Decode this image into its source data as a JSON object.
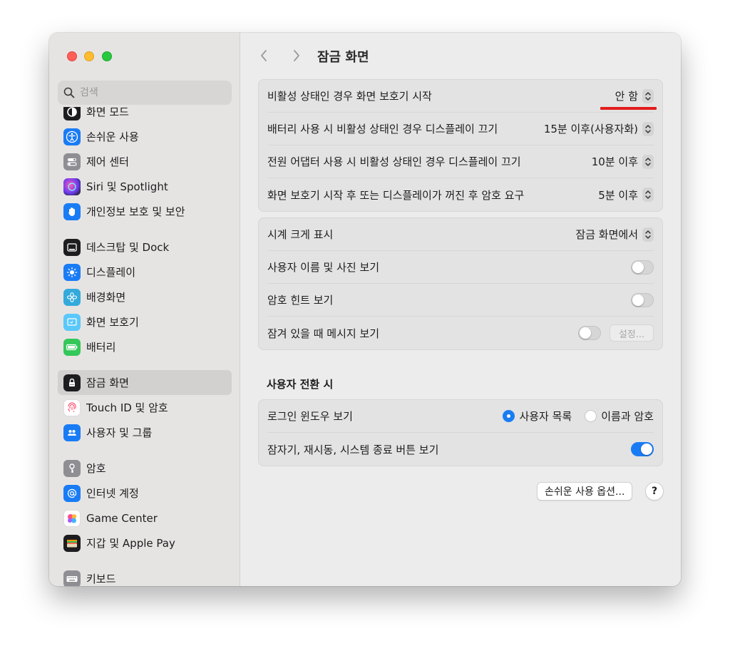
{
  "search": {
    "placeholder": "검색"
  },
  "sidebar": {
    "items": [
      {
        "label": "화면 모드",
        "icon": "display-mode-icon",
        "color": "#1d1d1f"
      },
      {
        "label": "손쉬운 사용",
        "icon": "accessibility-icon",
        "color": "#1a7cf5"
      },
      {
        "label": "제어 센터",
        "icon": "control-center-icon",
        "color": "#8e8e93"
      },
      {
        "label": "Siri 및 Spotlight",
        "icon": "siri-icon",
        "color": "#7a3cc8"
      },
      {
        "label": "개인정보 보호 및 보안",
        "icon": "hand-icon",
        "color": "#1a7cf5"
      },
      {
        "label": "데스크탑 및 Dock",
        "icon": "dock-icon",
        "color": "#1d1d1f"
      },
      {
        "label": "디스플레이",
        "icon": "sun-icon",
        "color": "#1a7cf5"
      },
      {
        "label": "배경화면",
        "icon": "flower-icon",
        "color": "#34aadc"
      },
      {
        "label": "화면 보호기",
        "icon": "screensaver-icon",
        "color": "#5ac8fa"
      },
      {
        "label": "배터리",
        "icon": "battery-icon",
        "color": "#34c759"
      },
      {
        "label": "잠금 화면",
        "icon": "lock-icon",
        "color": "#1d1d1f"
      },
      {
        "label": "Touch ID 및 암호",
        "icon": "fingerprint-icon",
        "color": "#ffffff"
      },
      {
        "label": "사용자 및 그룹",
        "icon": "users-icon",
        "color": "#1a7cf5"
      },
      {
        "label": "암호",
        "icon": "key-icon",
        "color": "#8e8e93"
      },
      {
        "label": "인터넷 계정",
        "icon": "at-icon",
        "color": "#1a7cf5"
      },
      {
        "label": "Game Center",
        "icon": "game-center-icon",
        "color": "#ffffff"
      },
      {
        "label": "지갑 및 Apple Pay",
        "icon": "wallet-icon",
        "color": "#1d1d1f"
      },
      {
        "label": "키보드",
        "icon": "keyboard-icon",
        "color": "#8e8e93"
      }
    ]
  },
  "toolbar": {
    "title": "잠금 화면"
  },
  "display_group": [
    {
      "label": "비활성 상태인 경우 화면 보호기 시작",
      "value": "안 함"
    },
    {
      "label": "배터리 사용 시 비활성 상태인 경우 디스플레이 끄기",
      "value": "15분 이후(사용자화)"
    },
    {
      "label": "전원 어댑터 사용 시 비활성 상태인 경우 디스플레이 끄기",
      "value": "10분 이후"
    },
    {
      "label": "화면 보호기 시작 후 또는 디스플레이가 꺼진 후 암호 요구",
      "value": "5분 이후"
    }
  ],
  "options_group": {
    "clock_label": "시계 크게 표시",
    "clock_value": "잠금 화면에서",
    "user_photo_label": "사용자 이름 및 사진 보기",
    "user_photo_on": false,
    "hint_label": "암호 힌트 보기",
    "hint_on": false,
    "message_label": "잠겨 있을 때 메시지 보기",
    "message_on": false,
    "settings_button": "설정..."
  },
  "switch_section": {
    "title": "사용자 전환 시",
    "login_label": "로그인 윈도우 보기",
    "radio_user_list": "사용자 목록",
    "radio_name_password": "이름과 암호",
    "selected": "user_list",
    "buttons_label": "잠자기, 재시동, 시스템 종료 버튼 보기",
    "buttons_on": true
  },
  "footer": {
    "accessibility_button": "손쉬운 사용 옵션...",
    "help_button": "?"
  },
  "colors": {
    "accent": "#1a7cf5",
    "annotation": "#e41d1d"
  }
}
